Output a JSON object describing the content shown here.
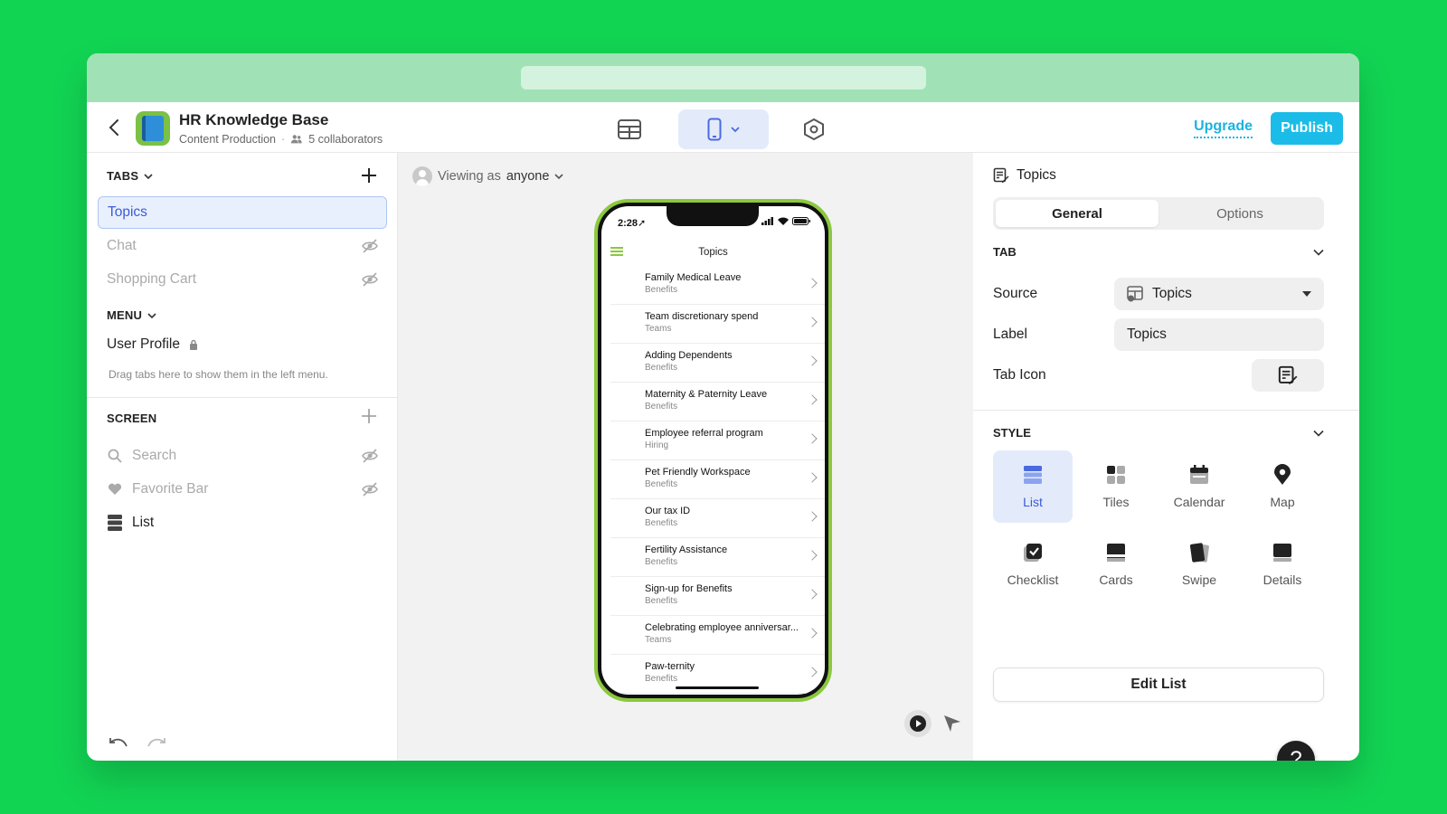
{
  "app": {
    "title": "HR Knowledge Base",
    "subtitle": "Content Production",
    "collaborators": "5 collaborators"
  },
  "toolbar": {
    "upgrade_label": "Upgrade",
    "publish_label": "Publish"
  },
  "left": {
    "tabs_header": "TABS",
    "tabs": [
      {
        "label": "Topics"
      },
      {
        "label": "Chat"
      },
      {
        "label": "Shopping Cart"
      }
    ],
    "menu_header": "MENU",
    "menu_item": "User Profile",
    "menu_note": "Drag tabs here to show them in the left menu.",
    "screen_header": "SCREEN",
    "screen_items": [
      {
        "label": "Search",
        "icon": "search-icon"
      },
      {
        "label": "Favorite Bar",
        "icon": "heart-icon"
      },
      {
        "label": "List",
        "icon": "list-icon"
      }
    ]
  },
  "preview": {
    "viewing_prefix": "Viewing as",
    "viewing_user": "anyone",
    "status_time": "2:28",
    "screen_title": "Topics",
    "rows": [
      {
        "title": "Family Medical Leave",
        "sub": "Benefits"
      },
      {
        "title": "Team discretionary spend",
        "sub": "Teams"
      },
      {
        "title": "Adding Dependents",
        "sub": "Benefits"
      },
      {
        "title": "Maternity & Paternity Leave",
        "sub": "Benefits"
      },
      {
        "title": "Employee referral program",
        "sub": "Hiring"
      },
      {
        "title": "Pet Friendly Workspace",
        "sub": "Benefits"
      },
      {
        "title": "Our tax ID",
        "sub": "Benefits"
      },
      {
        "title": "Fertility Assistance",
        "sub": "Benefits"
      },
      {
        "title": "Sign-up for Benefits",
        "sub": "Benefits"
      },
      {
        "title": "Celebrating employee anniversar...",
        "sub": "Teams"
      },
      {
        "title": "Paw-ternity",
        "sub": "Benefits"
      }
    ]
  },
  "right": {
    "title": "Topics",
    "seg_general": "General",
    "seg_options": "Options",
    "tab_header": "TAB",
    "source_label": "Source",
    "source_value": "Topics",
    "label_label": "Label",
    "label_value": "Topics",
    "tabicon_label": "Tab Icon",
    "style_header": "STYLE",
    "styles": [
      {
        "label": "List",
        "icon": "list-style-icon"
      },
      {
        "label": "Tiles",
        "icon": "tiles-icon"
      },
      {
        "label": "Calendar",
        "icon": "calendar-icon"
      },
      {
        "label": "Map",
        "icon": "map-pin-icon"
      },
      {
        "label": "Checklist",
        "icon": "checklist-icon"
      },
      {
        "label": "Cards",
        "icon": "cards-icon"
      },
      {
        "label": "Swipe",
        "icon": "swipe-icon"
      },
      {
        "label": "Details",
        "icon": "details-icon"
      }
    ],
    "edit_list_label": "Edit List",
    "help_label": "?"
  },
  "colors": {
    "background": "#12d453",
    "accent": "#1bbce8",
    "selection": "#3a5bd6",
    "phone_frame": "#8bc83f"
  }
}
